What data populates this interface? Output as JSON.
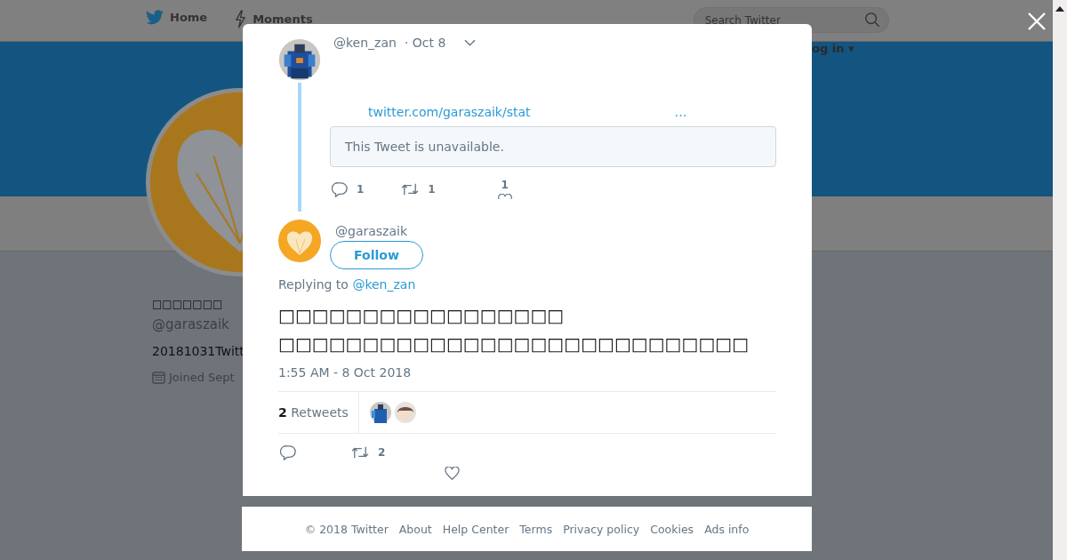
{
  "top_nav": {
    "items": [
      {
        "kind": "home",
        "label": "Home"
      },
      {
        "kind": "moments",
        "label": "Moments"
      }
    ],
    "search": {
      "placeholder": "Search Twitter"
    },
    "login": "og in ▾"
  },
  "profile": {
    "name": "□□□□□□□",
    "handle": "@garaszaik",
    "bio": "20181031Twitt",
    "joined": "Joined Sept"
  },
  "modal": {
    "parent_tweet": {
      "handle": "@ken_zan",
      "date": "· Oct 8",
      "link": "twitter.com/garaszaik/stat",
      "link_more": "…",
      "quote": "This Tweet is unavailable.",
      "replies": "1",
      "retweets": "1",
      "likes": "1"
    },
    "tweet": {
      "handle": "@garaszaik",
      "follow": "Follow",
      "replying_label": "Replying to",
      "replying_to": "@ken_zan",
      "text": "□□□□□□□□□□□□□□□□□\n□□□□□□□□□□□□□□□□□□□□□□□□□□□□",
      "time": "1:55 AM - 8 Oct 2018",
      "retweet_count": "2",
      "retweet_label": "Retweets",
      "action_retweets": "2"
    }
  },
  "footer": {
    "links": [
      "© 2018 Twitter",
      "About",
      "Help Center",
      "Terms",
      "Privacy policy",
      "Cookies",
      "Ads info"
    ]
  }
}
